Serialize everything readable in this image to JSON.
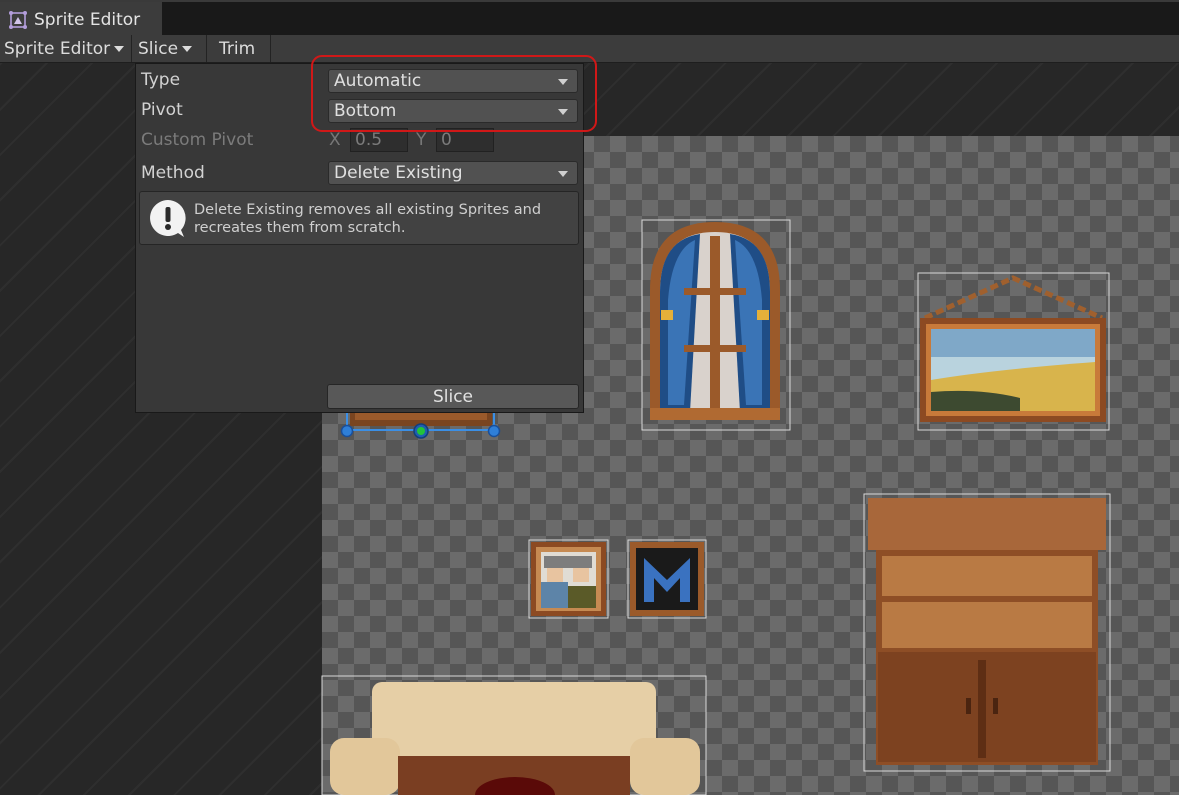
{
  "window": {
    "title": "Sprite Editor"
  },
  "toolbar": {
    "mode_label": "Sprite Editor",
    "slice_label": "Slice",
    "trim_label": "Trim"
  },
  "slice_panel": {
    "type": {
      "label": "Type",
      "value": "Automatic"
    },
    "pivot": {
      "label": "Pivot",
      "value": "Bottom"
    },
    "custom_pivot": {
      "label": "Custom Pivot",
      "x_label": "X",
      "x_value": "0.5",
      "y_label": "Y",
      "y_value": "0"
    },
    "method": {
      "label": "Method",
      "value": "Delete Existing"
    },
    "help_message": "Delete Existing removes all existing Sprites and recreates them from scratch.",
    "slice_button": "Slice"
  },
  "colors": {
    "highlight": "#d01818",
    "panel_bg": "#383838",
    "selection_handle": "#2f7fd8",
    "pivot_handle": "#22c33a"
  }
}
